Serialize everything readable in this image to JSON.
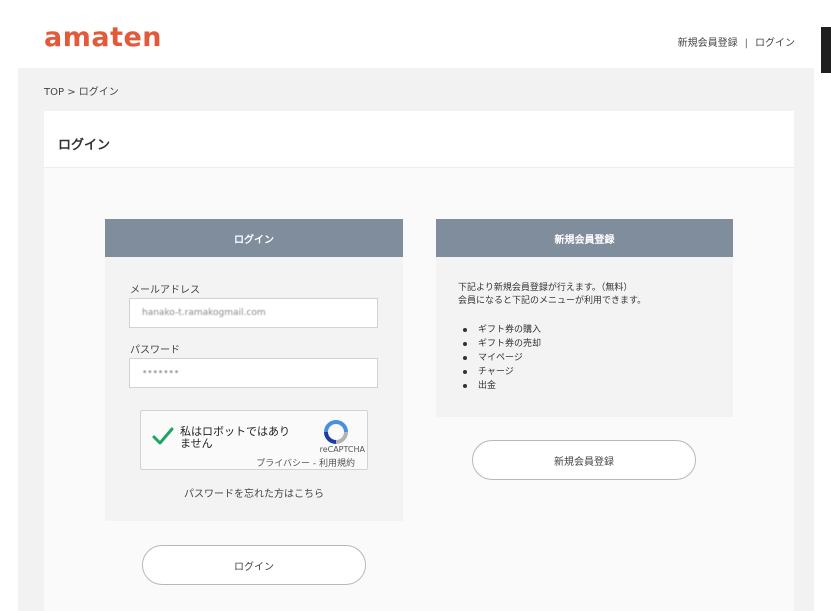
{
  "header": {
    "logo": "amaten",
    "register_link": "新規会員登録",
    "separator": "|",
    "login_link": "ログイン"
  },
  "breadcrumb": "TOP > ログイン",
  "panel": {
    "title": "ログイン"
  },
  "login_box": {
    "heading": "ログイン",
    "email_label": "メールアドレス",
    "email_value": "hanako-t.ramakogmail.com",
    "password_label": "パスワード",
    "password_value": "•••••••",
    "captcha": {
      "text": "私はロボットではありません",
      "brand": "reCAPTCHA",
      "links": "プライバシー - 利用規約"
    },
    "forgot": "パスワードを忘れた方はこちら",
    "submit": "ログイン"
  },
  "register_box": {
    "heading": "新規会員登録",
    "desc_line1": "下記より新規会員登録が行えます。（無料）",
    "desc_line2": "会員になると下記のメニューが利用できます。",
    "items": [
      "ギフト券の購入",
      "ギフト券の売却",
      "マイページ",
      "チャージ",
      "出金"
    ],
    "button": "新規会員登録"
  },
  "colors": {
    "brand": "#e25a3a",
    "box_header": "#7f8d9c",
    "check": "#1fa463"
  }
}
